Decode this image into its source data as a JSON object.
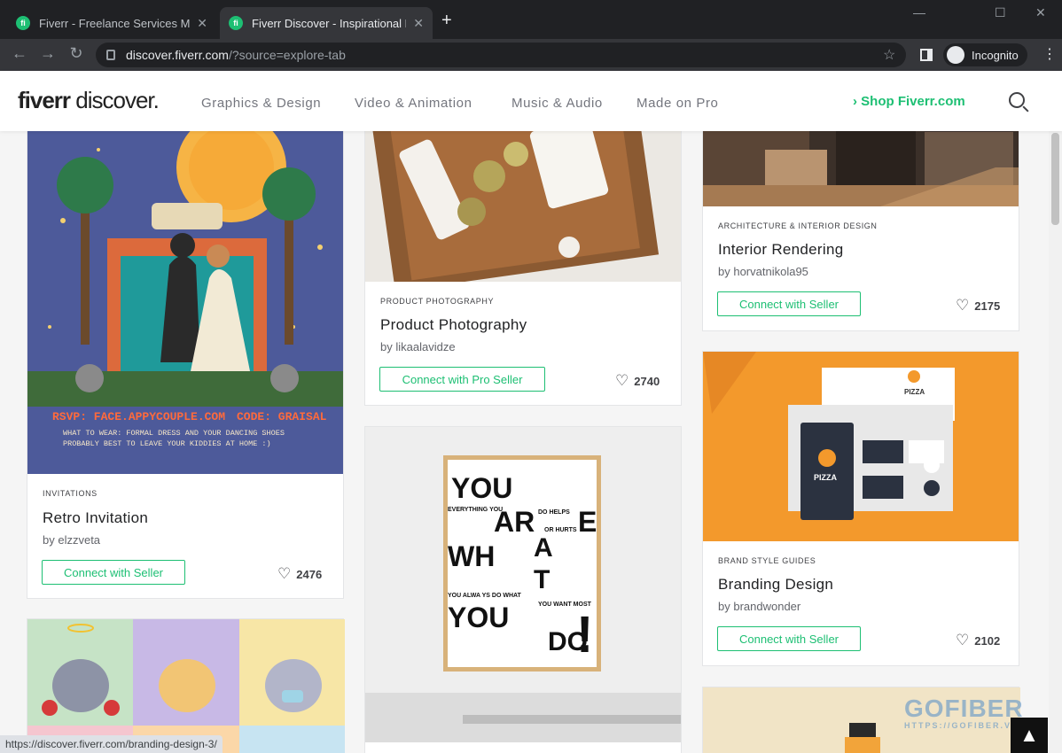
{
  "browser": {
    "tabs": [
      {
        "title": "Fiverr - Freelance Services Marketplace"
      },
      {
        "title": "Fiverr Discover - Inspirational Fiverr"
      }
    ],
    "url_domain": "discover.fiverr.com",
    "url_path": "/?source=explore-tab",
    "incognito_label": "Incognito",
    "favicon_text": "fi",
    "new_tab": "+",
    "win_min": "—",
    "win_max": "☐",
    "win_close": "✕",
    "tab_close": "✕",
    "back": "←",
    "forward": "→",
    "reload": "↻",
    "star": "☆",
    "menu": "⋮"
  },
  "header": {
    "logo_bold": "fiverr",
    "logo_light": " discover.",
    "nav": [
      "Graphics & Design",
      "Video & Animation",
      "Music & Audio",
      "Made on Pro"
    ],
    "shop": "›  Shop Fiverr.com"
  },
  "cards": [
    {
      "category": "INVITATIONS",
      "title": "Retro Invitation",
      "by": "by elzzveta",
      "button": "Connect with Seller",
      "likes": "2476",
      "poster_line1": "RSVP: FACE.APPYCOUPLE.COM",
      "poster_code": "CODE: GRAISAL",
      "poster_line2": "WHAT TO WEAR: FORMAL DRESS AND YOUR DANCING SHOES",
      "poster_line3": "PROBABLY BEST TO LEAVE YOUR KIDDIES AT HOME :)"
    },
    {
      "category": "PRODUCT PHOTOGRAPHY",
      "title": "Product Photography",
      "by": "by likaalavidze",
      "button": "Connect with Pro Seller",
      "likes": "2740"
    },
    {
      "category": "ARCHITECTURE & INTERIOR DESIGN",
      "title": "Interior Rendering",
      "by": "by horvatnikola95",
      "button": "Connect with Seller",
      "likes": "2175"
    },
    {
      "category": "BRAND STYLE GUIDES",
      "title": "Branding Design",
      "by": "by brandwonder",
      "button": "Connect with Seller",
      "likes": "2102",
      "brand_text": "PIZZA"
    }
  ],
  "poster": {
    "you1": "YOU",
    "everything": "EVERYTHING YOU",
    "ar": "AR",
    "e": "E",
    "do_helps": "DO HELPS",
    "or_hurts": "OR HURTS",
    "wh": "WH",
    "a": "A",
    "t": "T",
    "you_alwa": "YOU ALWA  YS  DO  WHAT",
    "you_want_most": "YOU WANT MOST",
    "you2": "YOU",
    "do": "DO",
    "excl": "!"
  },
  "status_url": "https://discover.fiverr.com/branding-design-3/",
  "watermark": "GOFIBER",
  "watermark_sub": "HTTPS://GOFIBER.VN/",
  "to_top": "▲",
  "heart": "♡"
}
